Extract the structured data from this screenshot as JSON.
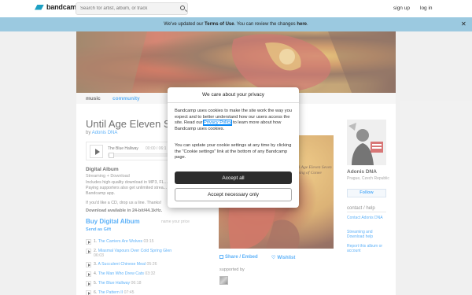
{
  "header": {
    "logo_text": "bandcamp",
    "search_placeholder": "Search for artist, album, or track",
    "signup": "sign up",
    "login": "log in"
  },
  "notice": {
    "text_before": "We've updated our ",
    "terms_link": "Terms of Use",
    "text_middle": ". You can review the changes ",
    "here_link": "here",
    "text_after": "."
  },
  "nav": {
    "music": "music",
    "community": "community"
  },
  "album": {
    "title": "Until Age Eleven S",
    "by_prefix": "by ",
    "artist": "Adonis DNA",
    "player": {
      "track": "The Blue Hallway",
      "time": "00:00 / 06:1",
      "progress": 0
    },
    "digital_title": "Digital Album",
    "digital_sub": "Streaming + Download",
    "digital_desc": "Includes high-quality download in MP3, FL... Paying supporters also get unlimited strea... Bandcamp app.",
    "cd_line": "If you'd like a CD, drop us a line. Thanks!",
    "download_note": "Download available in 24-bit/44.1kHz.",
    "buy_label": "Buy Digital Album",
    "price_hint": "name your price",
    "gift_label": "Send as Gift",
    "art_text": "Until Age Eleven Seven Nothing of Conee"
  },
  "tracks": [
    {
      "num": "1.",
      "title": "The Carriers Are Wolves",
      "duration": "03:15"
    },
    {
      "num": "2.",
      "title": "Miasmal Vapours Over Cold Spring Glen",
      "duration": "06:03"
    },
    {
      "num": "3.",
      "title": "A Succulent Chinese Meal",
      "duration": "05:26"
    },
    {
      "num": "4.",
      "title": "The Man Who Drew Cats",
      "duration": "03:32"
    },
    {
      "num": "5.",
      "title": "The Blue Hallway",
      "duration": "06:18"
    },
    {
      "num": "6.",
      "title": "The Pattern II",
      "duration": "07:45"
    }
  ],
  "share": {
    "share_label": "Share / Embed",
    "wishlist_label": "Wishlist",
    "supported_by": "supported by"
  },
  "artist": {
    "name": "Adonis DNA",
    "location": "Prague, Czech Republic",
    "follow": "Follow",
    "contact_title": "contact / help",
    "links": [
      "Contact Adonis DNA",
      "Streaming and Download help",
      "Report this album or account"
    ]
  },
  "cookie_modal": {
    "title": "We care about your privacy",
    "p1_before": "Bandcamp uses cookies to make the site work the way you expect and to better understand how our users access the site. Read our ",
    "privacy_link": "Privacy Policy",
    "p1_after": " to learn more about how Bandcamp uses cookies.",
    "p2": "You can update your cookie settings at any time by clicking the \"Cookie settings\" link at the bottom of any Bandcamp page.",
    "accept_all": "Accept all",
    "accept_necessary": "Accept necessary only"
  },
  "colors": {
    "link": "#0687f5",
    "banner": "#9bc9e0",
    "brand": "#1da0c3",
    "accept_button": "#2c2c2c"
  }
}
